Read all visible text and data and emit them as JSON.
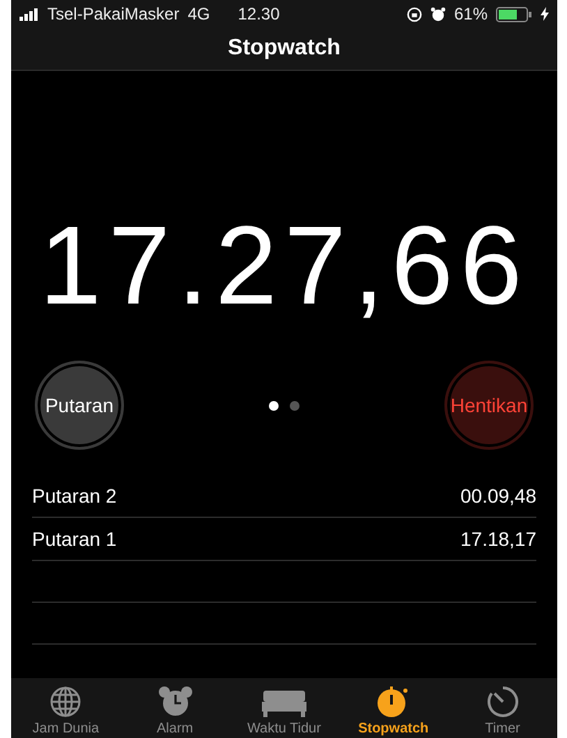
{
  "status_bar": {
    "carrier": "Tsel-PakaiMasker",
    "network": "4G",
    "time": "12.30",
    "battery": "61%"
  },
  "nav": {
    "title": "Stopwatch"
  },
  "timer": {
    "reading": "17.27,66"
  },
  "controls": {
    "lap_button": "Putaran",
    "stop_button": "Hentikan",
    "pages": [
      {
        "selected": true
      },
      {
        "selected": false
      }
    ]
  },
  "laps": [
    {
      "label": "Putaran 2",
      "time": "00.09,48"
    },
    {
      "label": "Putaran 1",
      "time": "17.18,17"
    }
  ],
  "tab_bar": [
    {
      "label": "Jam Dunia",
      "selected": false
    },
    {
      "label": "Alarm",
      "selected": false
    },
    {
      "label": "Waktu Tidur",
      "selected": false
    },
    {
      "label": "Stopwatch",
      "selected": true
    },
    {
      "label": "Timer",
      "selected": false
    }
  ]
}
